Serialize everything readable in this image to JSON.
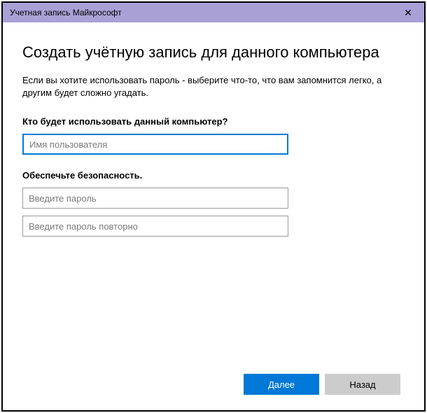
{
  "titlebar": {
    "title": "Учетная запись Майкрософт"
  },
  "page": {
    "heading": "Создать учётную запись для данного компьютера",
    "description": "Если вы хотите использовать пароль - выберите что-то, что вам запомнится легко, а другим будет сложно угадать."
  },
  "username_section": {
    "label": "Кто будет использовать данный компьютер?",
    "placeholder": "Имя пользователя"
  },
  "password_section": {
    "label": "Обеспечьте безопасность.",
    "password_placeholder": "Введите пароль",
    "confirm_placeholder": "Введите пароль повторно"
  },
  "buttons": {
    "next": "Далее",
    "back": "Назад"
  }
}
